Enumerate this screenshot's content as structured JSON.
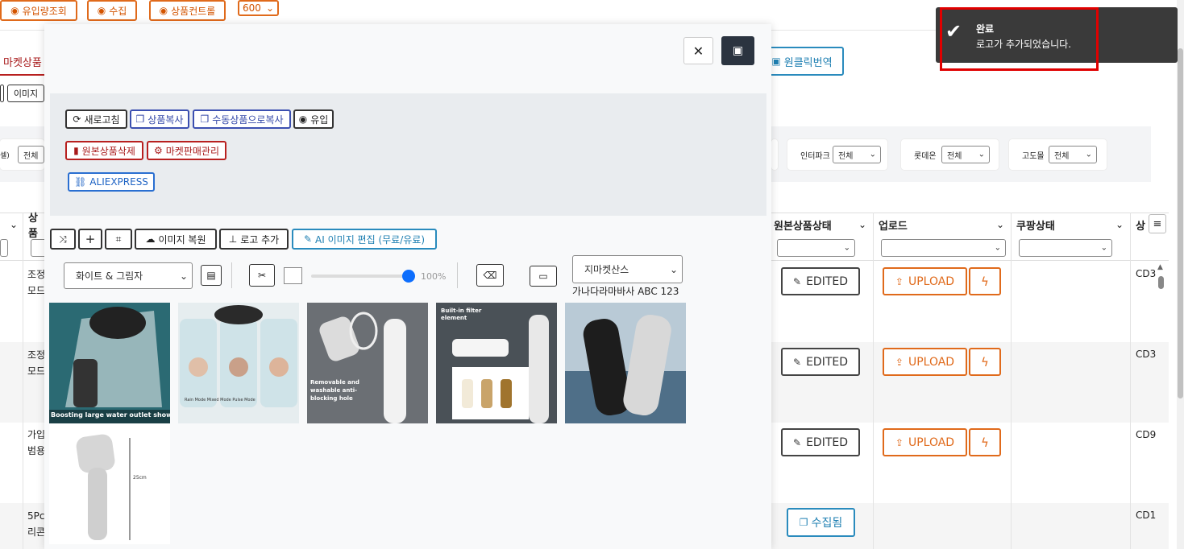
{
  "topbar": {
    "inflow_button": "유입량조회",
    "collect_button": "수집",
    "product_control_button": "상품컨트롤",
    "page_size": "600"
  },
  "background": {
    "market_tab": "마켓상품",
    "image_chip": "이미지",
    "oneclick_translate_button": "원클릭번역",
    "filters": [
      {
        "label": "인터파크",
        "value": "전체"
      },
      {
        "label": "롯데온",
        "value": "전체"
      },
      {
        "label": "고도몰",
        "value": "전체"
      }
    ],
    "left_filter_label": "셀)",
    "left_filter_value": "전체",
    "columns": {
      "product": "상품",
      "original_status": "원본상품상태",
      "upload": "업로드",
      "coupang_status": "쿠팡상태",
      "last": "상"
    },
    "rows": [
      {
        "name_line1": "조정",
        "name_line2": "모드",
        "status": "EDITED",
        "upload": "UPLOAD",
        "code": "CD3"
      },
      {
        "name_line1": "조정",
        "name_line2": "모드",
        "status": "EDITED",
        "upload": "UPLOAD",
        "code": "CD3"
      },
      {
        "name_line1": "가입",
        "name_line2": "범용",
        "status": "EDITED",
        "upload": "UPLOAD",
        "code": "CD9"
      },
      {
        "name_line1": "5Pc",
        "name_line2": "리콘",
        "collected": "수집됨",
        "code": "CD1"
      }
    ]
  },
  "modal": {
    "toolbar1": {
      "refresh": "새로고침",
      "copy_product": "상품복사",
      "copy_manual": "수동상품으로복사",
      "inflow": "유입",
      "delete_original": "원본상품삭제",
      "market_sales": "마켓판매관리",
      "aliexpress": "ALIEXPRESS"
    },
    "image_tools": {
      "restore_image": "이미지 복원",
      "add_logo": "로고 추가",
      "ai_edit": "AI 이미지 편집 (무료/유료)",
      "background_select": "화이트 & 그림자",
      "opacity_label": "100%",
      "opacity_value": 100,
      "font_select": "지마켓산스",
      "font_preview": "가나다라마바사 ABC 123"
    },
    "thumbnails": [
      {
        "caption": "Boosting large water outlet showerhead"
      },
      {
        "caption": "Rain Mode  Mixed Mode  Pulse Mode"
      },
      {
        "caption": "Removable and washable anti-blocking hole"
      },
      {
        "caption": "Built-in filter element"
      },
      {
        "caption": ""
      },
      {
        "caption": "25cm"
      }
    ]
  },
  "toast": {
    "title": "완료",
    "message": "로고가 추가되었습니다."
  },
  "colors": {
    "orange": "#e06a1b",
    "navy": "#3146a8",
    "red": "#a8191a",
    "toast_bg": "#3a3a3a",
    "highlight": "#e00000"
  }
}
